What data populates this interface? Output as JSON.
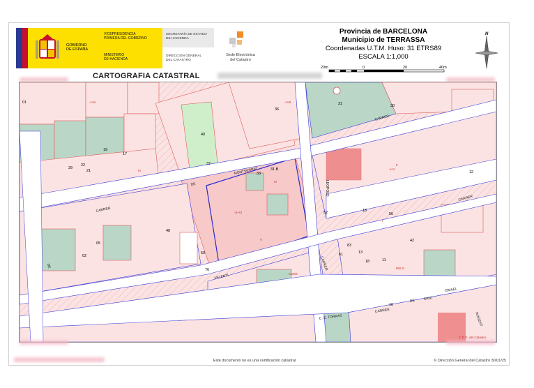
{
  "header": {
    "gov_logo": {
      "line1": "GOBIERNO",
      "line2": "DE ESPAÑA",
      "vice_1": "VICEPRESIDENCIA",
      "vice_2": "PRIMERA DEL GOBIERNO",
      "min_1": "MINISTERIO",
      "min_2": "DE HACIENDA"
    },
    "sec_estado_1": "SECRETARÍA DE ESTADO",
    "sec_estado_2": "DE HACIENDA",
    "dir_general_1": "DIRECCIÓN GENERAL",
    "dir_general_2": "DEL CATASTRO",
    "sede_1": "Sede Electrónica",
    "sede_2": "del Catastro",
    "province": "Provincia de BARCELONA",
    "municipality": "Municipio de TERRASSA",
    "coords": "Coordenadas U.T.M. Huso: 31 ETRS89",
    "scale_text": "ESCALA 1:1,000",
    "scale_ticks": [
      "20m",
      "0",
      "20",
      "40m"
    ],
    "compass_label": "N",
    "carto_title": "CARTOGRAFIA CATASTRAL"
  },
  "map": {
    "streets": [
      "CARRER",
      "DE",
      "MONTSERRAT",
      "LEOPOLD",
      "CARRER",
      "DE",
      "VALENTÍ",
      "CARRER",
      "CARRER",
      "CARRER",
      "DE",
      "SANT",
      "ISMAEL",
      "C. E. TORRAS",
      "ROGENT"
    ],
    "block_numbers": [
      "01",
      "36",
      "31",
      "30",
      "37",
      "40",
      "19",
      "22",
      "21",
      "39",
      "17",
      "33",
      "31 B",
      "12",
      "02",
      "05",
      "18",
      "50",
      "76",
      "16",
      "52",
      "56",
      "42",
      "48",
      "61",
      "83",
      "13",
      "18",
      "11"
    ],
    "building_codes": [
      "-I+III",
      "-I+IV",
      "IV",
      "V",
      "III",
      "II",
      "I",
      "-II+VI",
      "-I+II",
      "INS.S",
      "COSS"
    ],
    "copyright_corner": "© D.G. del Catastro"
  },
  "footer": {
    "disclaimer": "Este documento no es una certificación catastral",
    "copyright": "© Dirección General del Catastro 30/01/25"
  },
  "colors": {
    "parcel_fill": "#fbe3e3",
    "parcel_line": "#e05a5a",
    "road": "#ffffff",
    "block_line": "#3a3ad8",
    "yard": "#b9d6c7",
    "green_area": "#cfeeca",
    "highlight": "#2a2ad0",
    "logo_yellow": "#fde000",
    "flag_red": "#c8102e"
  }
}
